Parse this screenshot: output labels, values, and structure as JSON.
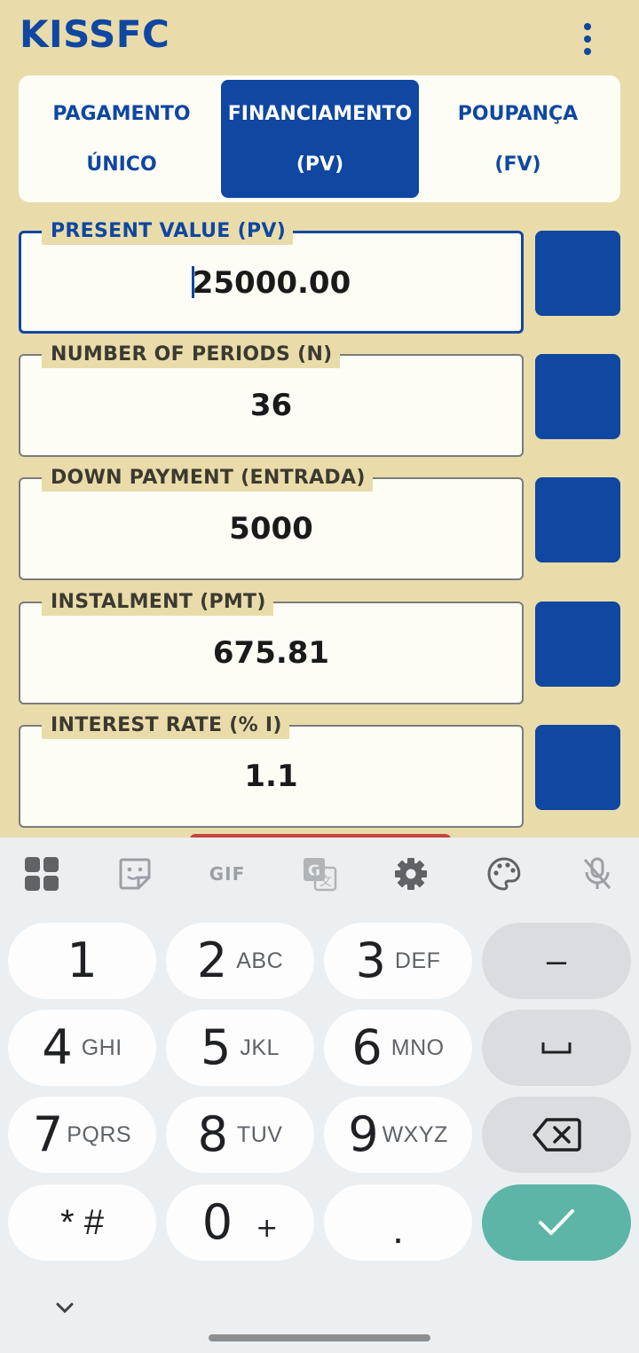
{
  "app": {
    "title": "KISSFC"
  },
  "tabs": [
    {
      "line1": "PAGAMENTO",
      "line2": "ÚNICO",
      "active": false
    },
    {
      "line1": "FINANCIAMENTO",
      "line2": "(PV)",
      "active": true
    },
    {
      "line1": "POUPANÇA",
      "line2": "(FV)",
      "active": false
    }
  ],
  "fields": [
    {
      "label": "PRESENT VALUE (PV)",
      "value": "25000.00",
      "focused": true
    },
    {
      "label": "NUMBER OF PERIODS (N)",
      "value": "36",
      "focused": false
    },
    {
      "label": "DOWN PAYMENT (ENTRADA)",
      "value": "5000",
      "focused": false
    },
    {
      "label": "INSTALMENT (PMT)",
      "value": "675.81",
      "focused": false
    },
    {
      "label": "INTEREST RATE (% I)",
      "value": "1.1",
      "focused": false
    }
  ],
  "colors": {
    "background": "#e9dcaa",
    "accent": "#0f47a1",
    "field_bg": "#fdfcf5",
    "keyboard_bg": "#ebeff2",
    "enter_key": "#5cb5a6"
  },
  "keyboard": {
    "toolbar_icons": [
      "apps-grid-icon",
      "sticker-icon",
      "gif-icon",
      "translate-icon",
      "gear-icon",
      "palette-icon",
      "mic-off-icon"
    ],
    "gif_label": "GIF",
    "keys": {
      "k1": {
        "main": "1",
        "sub": ""
      },
      "k2": {
        "main": "2",
        "sub": "ABC"
      },
      "k3": {
        "main": "3",
        "sub": "DEF"
      },
      "k4": {
        "main": "4",
        "sub": "GHI"
      },
      "k5": {
        "main": "5",
        "sub": "JKL"
      },
      "k6": {
        "main": "6",
        "sub": "MNO"
      },
      "k7": {
        "main": "7",
        "sub": "PQRS"
      },
      "k8": {
        "main": "8",
        "sub": "TUV"
      },
      "k9": {
        "main": "9",
        "sub": "WXYZ"
      },
      "star": {
        "main": "* #"
      },
      "k0": {
        "main": "0",
        "sub": "+"
      },
      "dot": {
        "main": "."
      },
      "minus": {
        "main": "–"
      }
    }
  }
}
